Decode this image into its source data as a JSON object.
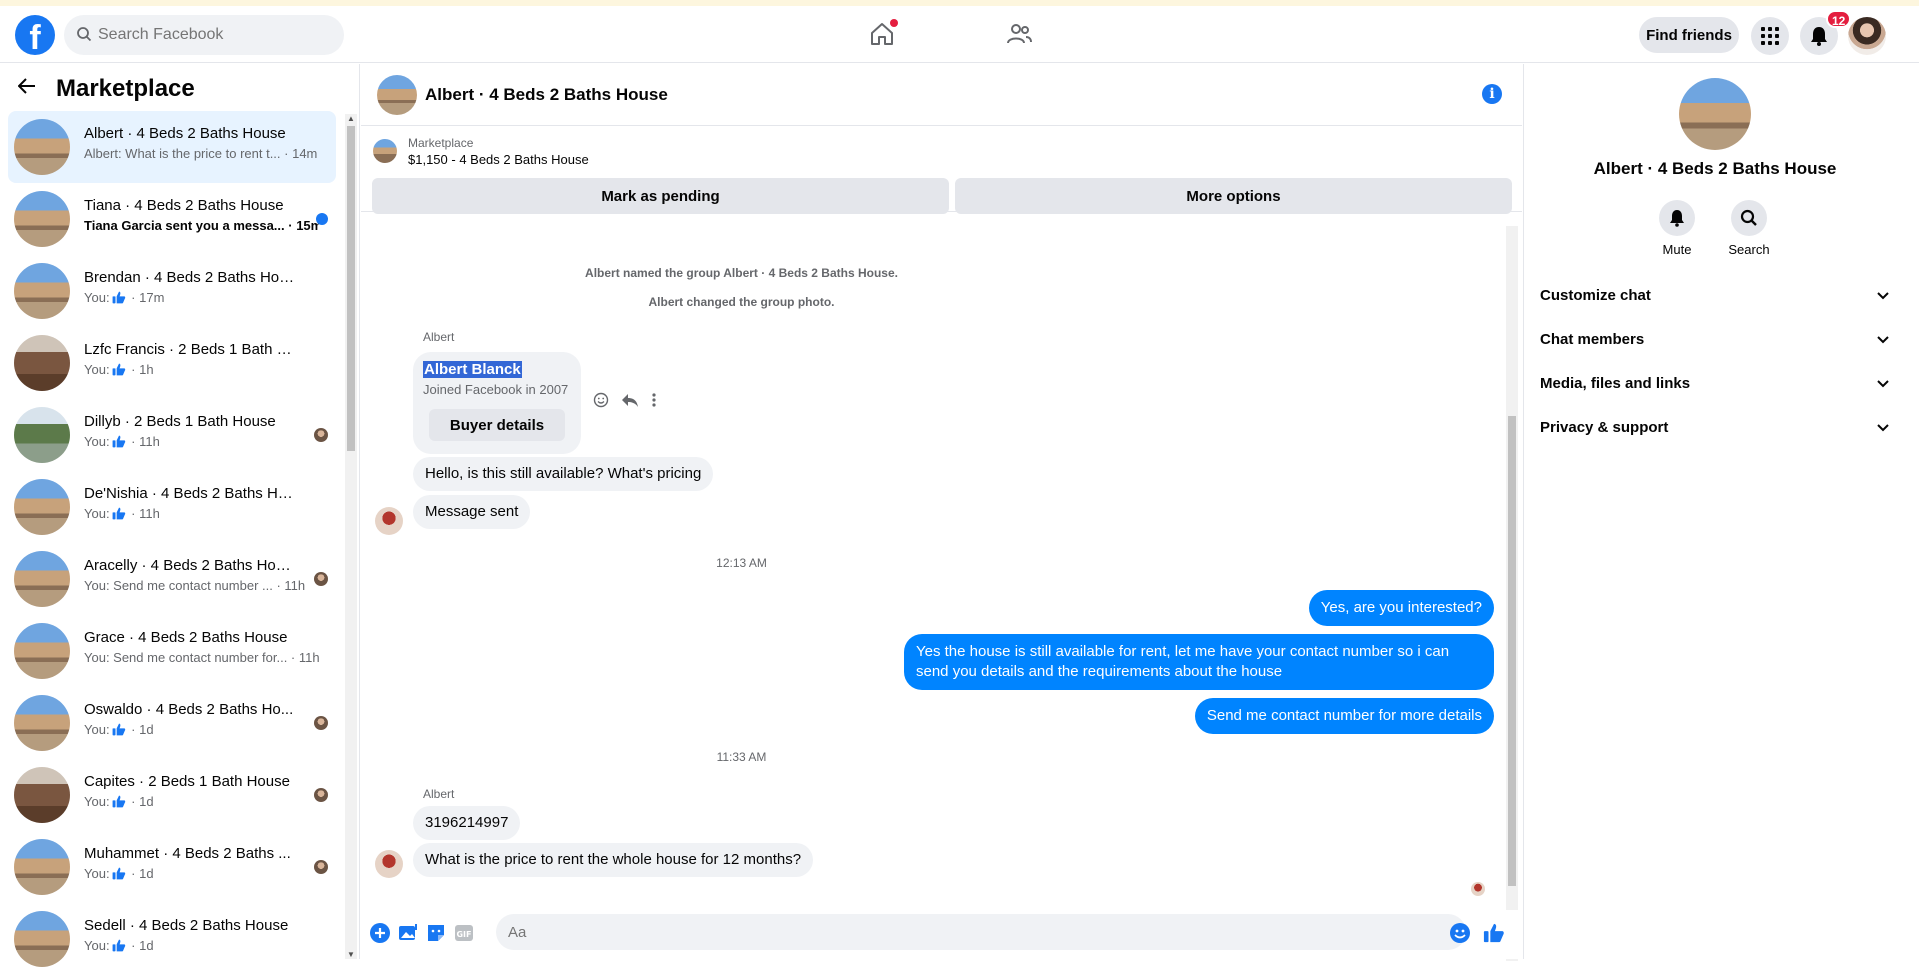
{
  "topnav": {
    "logo": "f",
    "search_placeholder": "Search Facebook",
    "find_friends": "Find friends",
    "notification_count": "12"
  },
  "sidebar": {
    "title": "Marketplace",
    "conversations": [
      {
        "name": "Albert · 4 Beds 2 Baths House",
        "preview": "Albert: What is the price to rent t...",
        "time": "14m",
        "thumb": "house",
        "active": true,
        "status": "none"
      },
      {
        "name": "Tiana · 4 Beds 2 Baths House",
        "preview": "Tiana Garcia sent you a messa...",
        "time": "15m",
        "thumb": "house",
        "unread": true,
        "status": "dot"
      },
      {
        "name": "Brendan · 4 Beds 2 Baths House",
        "preview": "You:",
        "like": true,
        "time": "17m",
        "thumb": "house",
        "status": "none"
      },
      {
        "name": "Lzfc Francis · 2 Beds 1 Bath House",
        "preview": "You:",
        "like": true,
        "time": "1h",
        "thumb": "room",
        "status": "none"
      },
      {
        "name": "Dillyb · 2 Beds 1 Bath House",
        "preview": "You:",
        "like": true,
        "time": "11h",
        "thumb": "tree",
        "status": "avatar"
      },
      {
        "name": "De'Nishia · 4 Beds 2 Baths House",
        "preview": "You:",
        "like": true,
        "time": "11h",
        "thumb": "house",
        "status": "none"
      },
      {
        "name": "Aracelly · 4 Beds 2 Baths House",
        "preview": "You: Send me contact number ...",
        "time": "11h",
        "thumb": "house",
        "status": "avatar"
      },
      {
        "name": "Grace · 4 Beds 2 Baths House",
        "preview": "You: Send me contact number for...",
        "time": "11h",
        "thumb": "house",
        "status": "none"
      },
      {
        "name": "Oswaldo · 4 Beds 2 Baths Ho...",
        "preview": "You:",
        "like": true,
        "time": "1d",
        "thumb": "house",
        "status": "avatar"
      },
      {
        "name": "Capites · 2 Beds 1 Bath House",
        "preview": "You:",
        "like": true,
        "time": "1d",
        "thumb": "room",
        "status": "avatar"
      },
      {
        "name": "Muhammet · 4 Beds 2 Baths ...",
        "preview": "You:",
        "like": true,
        "time": "1d",
        "thumb": "house",
        "status": "avatar"
      },
      {
        "name": "Sedell · 4 Beds 2 Baths House",
        "preview": "You:",
        "like": true,
        "time": "1d",
        "thumb": "house",
        "status": "none"
      }
    ]
  },
  "chat": {
    "title": "Albert · 4 Beds 2 Baths House",
    "listing_source": "Marketplace",
    "listing_desc": "$1,150 - 4 Beds 2 Baths House",
    "mark_pending": "Mark as pending",
    "more_options": "More options",
    "sys1": "Albert named the group Albert · 4 Beds 2 Baths House.",
    "sys2": "Albert changed the group photo.",
    "sender": "Albert",
    "card_name": "Albert Blanck",
    "card_joined": "Joined Facebook in 2007",
    "buyer_details": "Buyer details",
    "msg_in_1": "Hello, is this still available? What's pricing",
    "msg_in_2": "Message sent",
    "time1": "12:13 AM",
    "msg_out_1": "Yes, are you interested?",
    "msg_out_2": "Yes the house is still available for rent, let me have your contact number so i can send you details and the requirements about the house",
    "msg_out_3": "Send me contact number for more details",
    "time2": "11:33 AM",
    "sender2": "Albert",
    "msg_in_3": "3196214997",
    "msg_in_4": "What is the price to rent the whole house for 12 months?",
    "composer_placeholder": "Aa"
  },
  "rpanel": {
    "title": "Albert · 4 Beds 2 Baths House",
    "mute": "Mute",
    "search": "Search",
    "items": [
      "Customize chat",
      "Chat members",
      "Media, files and links",
      "Privacy & support"
    ]
  },
  "colors": {
    "accent": "#1877f2",
    "bubble_out": "#0084ff",
    "bubble_in": "#f0f2f5",
    "active_row": "#e7f3ff"
  }
}
